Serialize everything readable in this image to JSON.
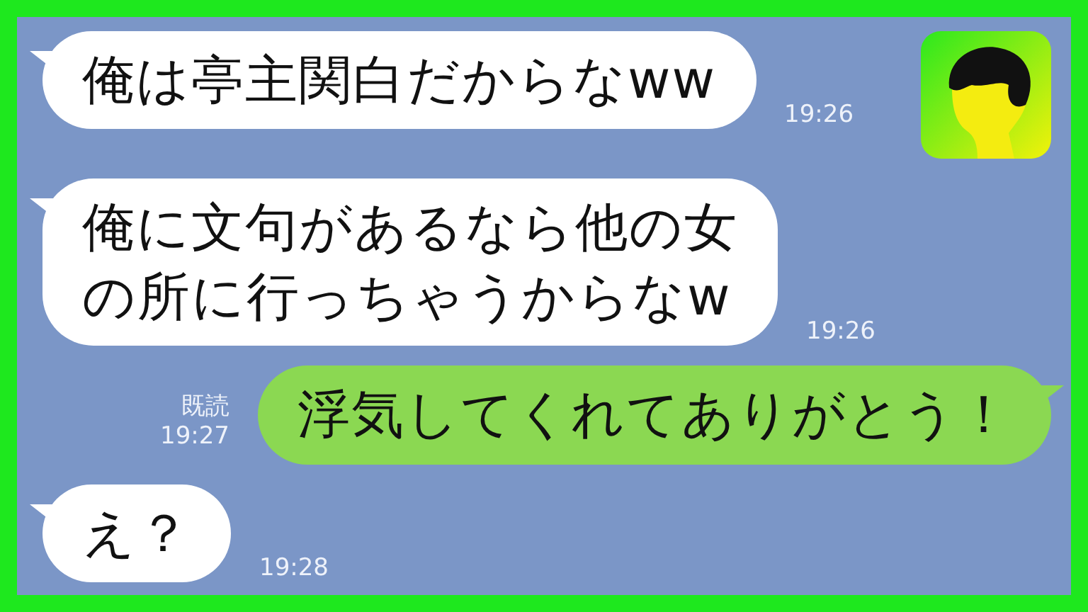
{
  "messages": [
    {
      "kind": "incoming",
      "lines": [
        "俺は亭主関白だからなww"
      ],
      "time": "19:26"
    },
    {
      "kind": "incoming",
      "lines": [
        "俺に文句があるなら他の女",
        "の所に行っちゃうからなw"
      ],
      "time": "19:26"
    },
    {
      "kind": "outgoing",
      "lines": [
        "浮気してくれてありがとう！"
      ],
      "read_label": "既読",
      "time": "19:27"
    },
    {
      "kind": "incoming",
      "lines": [
        "え？"
      ],
      "time": "19:28"
    }
  ]
}
